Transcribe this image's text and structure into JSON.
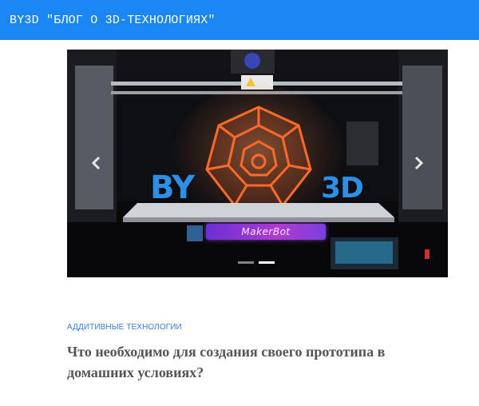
{
  "header": {
    "site_title": "BY3D \"БЛОГ О 3D-ТЕХНОЛОГИЯХ\""
  },
  "carousel": {
    "overlay_left": "BY",
    "overlay_right": "3D",
    "brand_badge": "MakerBot",
    "prev_icon": "chevron-left-icon",
    "next_icon": "chevron-right-icon",
    "slide_count": 2,
    "active_slide": 2
  },
  "post": {
    "category": "Аддитивные технологии",
    "title": "Что необходимо для создания своего прототипа в домашних условиях?"
  },
  "colors": {
    "header_bg": "#1a86f3",
    "accent_blue": "#2e8fe6",
    "category_link": "#3b7ddd",
    "printed_object": "#ff6a2b"
  }
}
